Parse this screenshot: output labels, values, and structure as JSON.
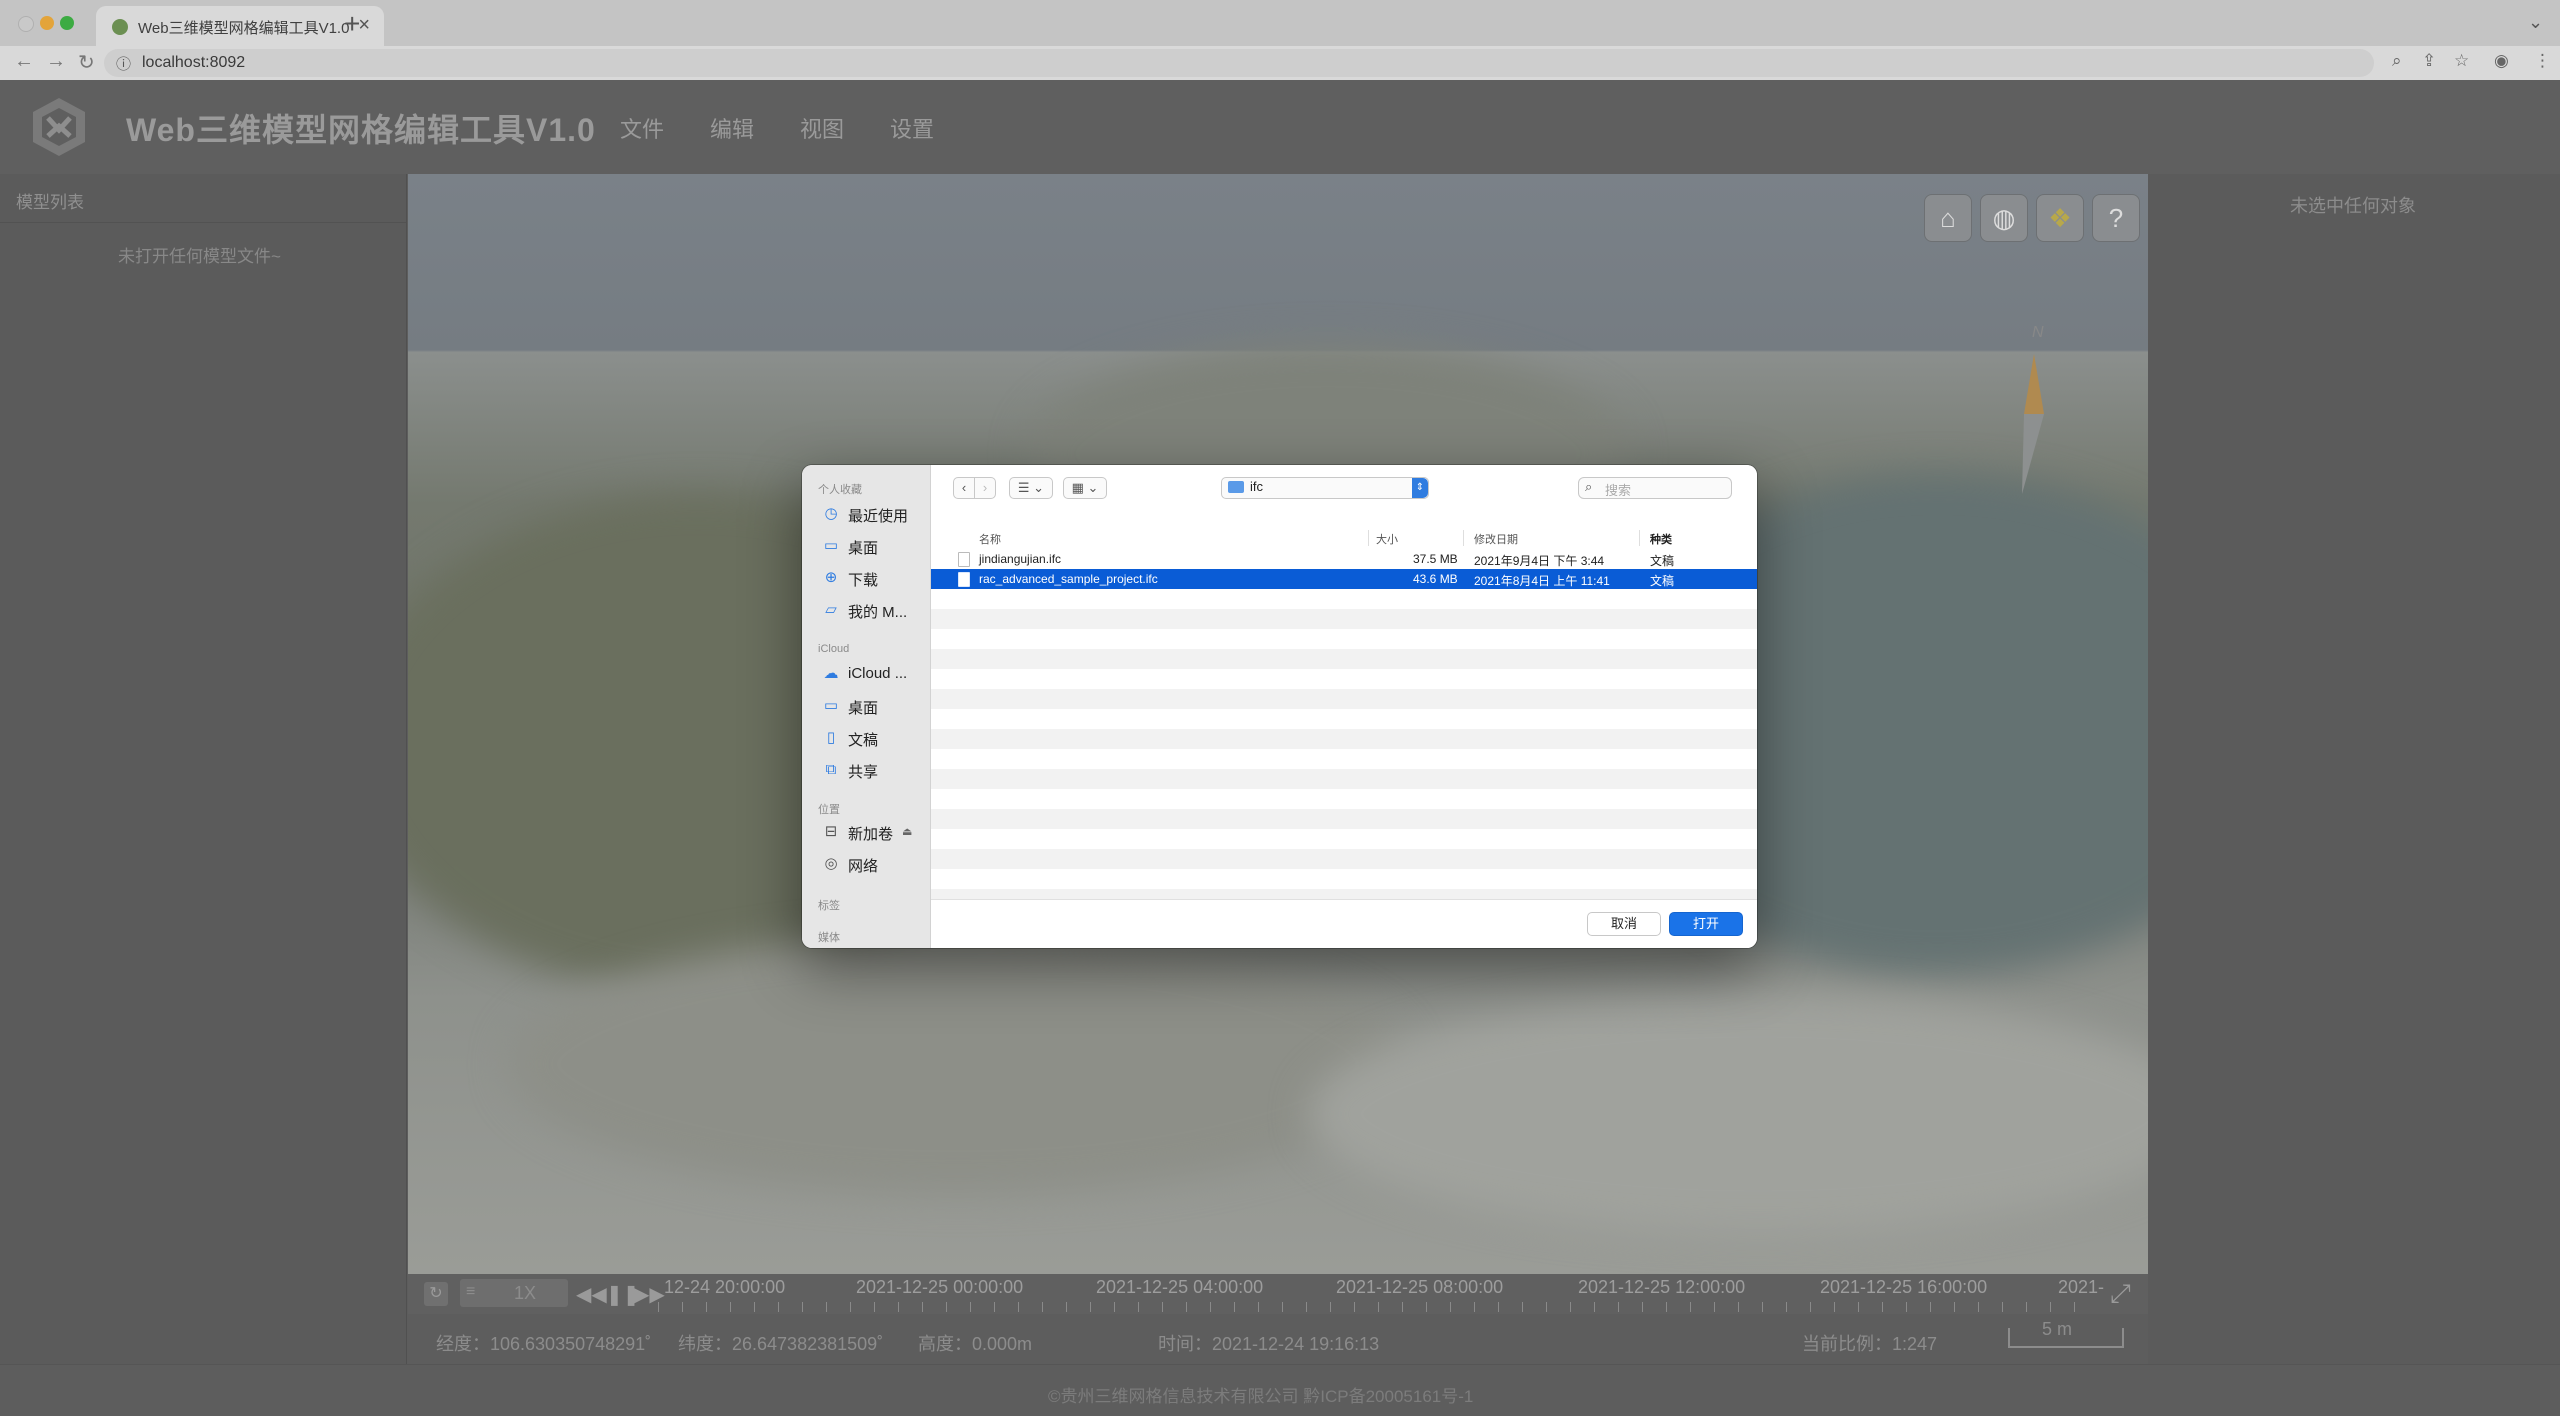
{
  "browser": {
    "tab_title": "Web三维模型网格编辑工具V1.0",
    "url": "localhost:8092",
    "new_tab": "+",
    "close_tab": "×"
  },
  "app": {
    "title": "Web三维模型网格编辑工具V1.0",
    "menu": [
      "文件",
      "编辑",
      "视图",
      "设置"
    ]
  },
  "left_panel": {
    "title": "模型列表",
    "empty_text": "未打开任何模型文件~"
  },
  "right_panel": {
    "empty_text": "未选中任何对象"
  },
  "viewport": {
    "compass_label": "N",
    "buttons": [
      "home-icon",
      "globe-icon",
      "map-layers-icon",
      "help-icon"
    ]
  },
  "timeline": {
    "speed": "1X",
    "labels": [
      "12-24 20:00:00",
      "2021-12-25 00:00:00",
      "2021-12-25 04:00:00",
      "2021-12-25 08:00:00",
      "2021-12-25 12:00:00",
      "2021-12-25 16:00:00",
      "2021-"
    ]
  },
  "status": {
    "longitude": "经度：106.630350748291˚",
    "latitude": "纬度：26.647382381509˚",
    "height": "高度：0.000m",
    "time": "时间：2021-12-24 19:16:13",
    "scale_ratio": "当前比例：1:247",
    "scale_bar": "5 m"
  },
  "footer": {
    "text": "©贵州三维网格信息技术有限公司   黔ICP备20005161号-1"
  },
  "dialog": {
    "sidebar": {
      "favorites_title": "个人收藏",
      "favorites": [
        {
          "label": "最近使用",
          "icon": "clock-icon"
        },
        {
          "label": "桌面",
          "icon": "desktop-icon"
        },
        {
          "label": "下载",
          "icon": "download-icon"
        },
        {
          "label": "我的 M...",
          "icon": "folder-icon"
        }
      ],
      "icloud_title": "iCloud",
      "icloud": [
        {
          "label": "iCloud ...",
          "icon": "cloud-icon"
        },
        {
          "label": "桌面",
          "icon": "desktop-icon"
        },
        {
          "label": "文稿",
          "icon": "document-icon"
        },
        {
          "label": "共享",
          "icon": "shared-folder-icon"
        }
      ],
      "locations_title": "位置",
      "locations": [
        {
          "label": "新加卷",
          "icon": "drive-icon"
        },
        {
          "label": "网络",
          "icon": "network-icon"
        }
      ],
      "tags_title": "标签",
      "media_title": "媒体"
    },
    "path": "ifc",
    "search_placeholder": "搜索",
    "columns": {
      "name": "名称",
      "size": "大小",
      "modified": "修改日期",
      "kind": "种类"
    },
    "files": [
      {
        "name": "jindiangujian.ifc",
        "size": "37.5 MB",
        "modified": "2021年9月4日 下午 3:44",
        "kind": "文稿",
        "selected": false
      },
      {
        "name": "rac_advanced_sample_project.ifc",
        "size": "43.6 MB",
        "modified": "2021年8月4日 上午 11:41",
        "kind": "文稿",
        "selected": true
      }
    ],
    "cancel_label": "取消",
    "open_label": "打开"
  }
}
